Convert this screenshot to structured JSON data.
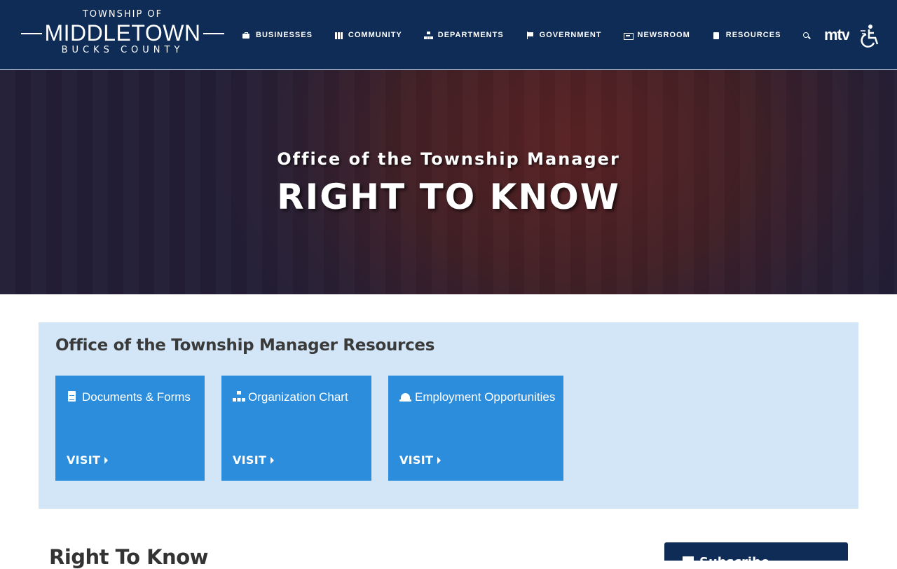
{
  "logo": {
    "top": "TOWNSHIP OF",
    "main": "MIDDLETOWN",
    "bottom": "BUCKS COUNTY"
  },
  "nav": {
    "items": [
      {
        "label": "BUSINESSES",
        "icon": "briefcase-icon"
      },
      {
        "label": "COMMUNITY",
        "icon": "building-icon"
      },
      {
        "label": "DEPARTMENTS",
        "icon": "sitemap-icon"
      },
      {
        "label": "GOVERNMENT",
        "icon": "flag-icon"
      },
      {
        "label": "NEWSROOM",
        "icon": "newspaper-icon"
      },
      {
        "label": "RESOURCES",
        "icon": "clipboard-icon"
      }
    ],
    "search_icon": "search-icon",
    "mtv_text": "mtv",
    "accessibility_icon": "wheelchair-icon"
  },
  "hero": {
    "subtitle": "Office of the Township Manager",
    "title": "RIGHT TO KNOW"
  },
  "resources": {
    "title": "Office of the Township Manager Resources",
    "cards": [
      {
        "title": "Documents & Forms",
        "icon": "document-icon",
        "action": "VISIT"
      },
      {
        "title": "Organization Chart",
        "icon": "sitemap-icon",
        "action": "VISIT"
      },
      {
        "title": "Employment Opportunities",
        "icon": "hard-hat-icon",
        "action": "VISIT"
      }
    ]
  },
  "main": {
    "heading": "Right To Know"
  },
  "sidebar": {
    "title": "Subscribe"
  },
  "colors": {
    "header_bg": "#0e2c55",
    "card_bg": "#2b8ddb",
    "panel_bg": "#d2e6f7"
  }
}
